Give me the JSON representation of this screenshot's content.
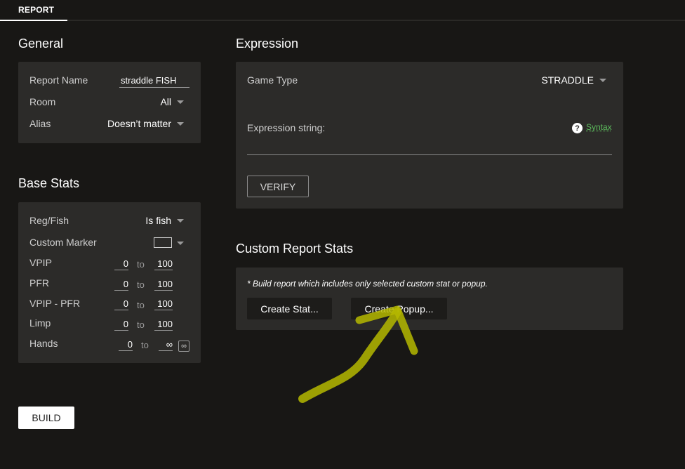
{
  "tabs": [
    {
      "label": "REPORT"
    }
  ],
  "general": {
    "title": "General",
    "report_name_label": "Report Name",
    "report_name_value": "straddle FISH",
    "room_label": "Room",
    "room_value": "All",
    "alias_label": "Alias",
    "alias_value": "Doesn’t matter"
  },
  "base_stats": {
    "title": "Base Stats",
    "reg_fish_label": "Reg/Fish",
    "reg_fish_value": "Is fish",
    "custom_marker_label": "Custom Marker",
    "to_label": "to",
    "ranges": [
      {
        "label": "VPIP",
        "min": "0",
        "max": "100"
      },
      {
        "label": "PFR",
        "min": "0",
        "max": "100"
      },
      {
        "label": "VPIP - PFR",
        "min": "0",
        "max": "100"
      },
      {
        "label": "Limp",
        "min": "0",
        "max": "100"
      },
      {
        "label": "Hands",
        "min": "0",
        "max": "∞"
      }
    ],
    "infinity_symbol": "∞"
  },
  "expression": {
    "title": "Expression",
    "game_type_label": "Game Type",
    "game_type_value": "STRADDLE",
    "expression_label": "Expression string:",
    "help_symbol": "?",
    "syntax_link": "Syntax",
    "verify_label": "VERIFY"
  },
  "custom_stats": {
    "title": "Custom Report Stats",
    "note": "* Build report which includes only selected custom stat or popup.",
    "create_stat_label": "Create Stat...",
    "create_popup_label": "Create Popup..."
  },
  "build_label": "BUILD",
  "colors": {
    "background": "#181715",
    "panel": "#2c2b29",
    "link": "#5dbb5d",
    "annotation_arrow": "#b5b800"
  },
  "icons": [
    "caret-down-icon",
    "help-circle-icon",
    "infinity-icon",
    "annotation-arrow-icon"
  ]
}
